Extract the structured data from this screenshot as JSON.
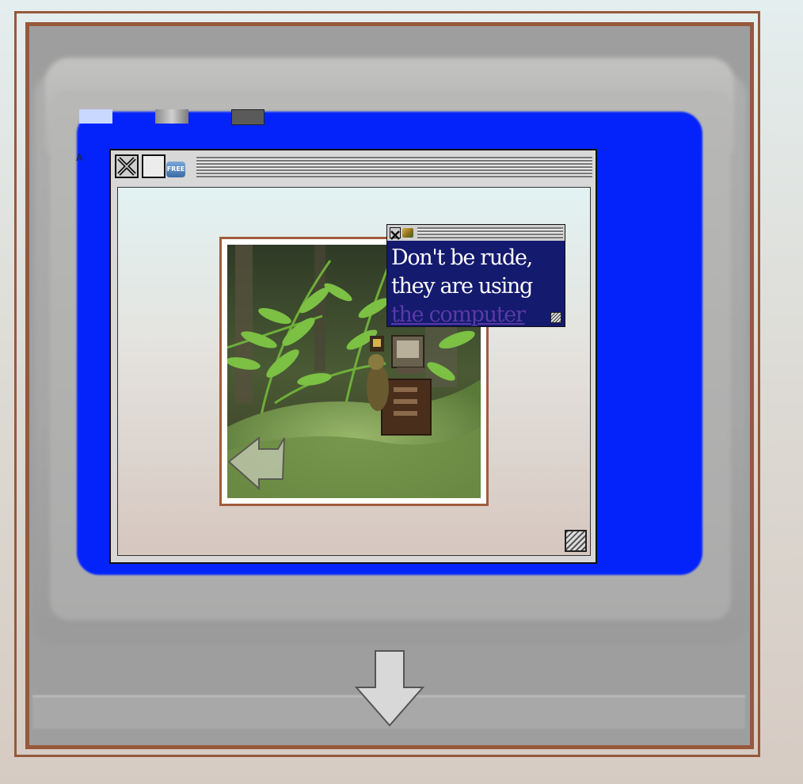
{
  "desktop": {
    "icon_label_partial": "A"
  },
  "main_window": {
    "badge": "FREE",
    "photo_alt": "Miniature computer desk among ferns and moss"
  },
  "dialog": {
    "text_prefix": "Don't be rude, they are using ",
    "link_text": "the computer"
  },
  "colors": {
    "frame": "#98583a",
    "screen": "#0323fa",
    "dialog_bg": "#141a6e",
    "link": "#5a3aa6"
  },
  "icons": {
    "close": "close-icon",
    "back": "left-arrow-icon",
    "next": "down-arrow-icon",
    "resize": "resize-grip-icon"
  }
}
